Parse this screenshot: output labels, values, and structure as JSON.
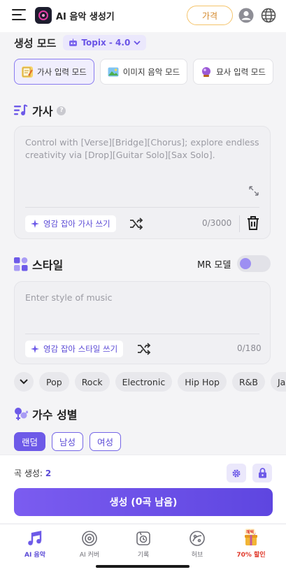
{
  "header": {
    "app_title": "AI 음악 생성기",
    "price_button": "가격"
  },
  "mode_section": {
    "label": "생성 모드",
    "model": "Topix - 4.0",
    "tabs": [
      {
        "label": "가사 입력 모드",
        "icon": "memo-icon",
        "active": true
      },
      {
        "label": "이미지 음악 모드",
        "icon": "image-icon",
        "active": false
      },
      {
        "label": "묘사 입력 모드",
        "icon": "crystal-ball-icon",
        "active": false
      }
    ]
  },
  "lyrics": {
    "title": "가사",
    "help": "?",
    "placeholder": "Control with [Verse][Bridge][Chorus]; explore endless creativity via [Drop][Guitar Solo][Sax Solo].",
    "inspire_button": "영감 잡아 가사 쓰기",
    "counter": "0/3000"
  },
  "style": {
    "title": "스타일",
    "mr_label": "MR 모델",
    "placeholder": "Enter style of music",
    "inspire_button": "영감 잡아 스타일 쓰기",
    "counter": "0/180",
    "genres": [
      "Pop",
      "Rock",
      "Electronic",
      "Hip Hop",
      "R&B",
      "Jazz"
    ]
  },
  "singer": {
    "title": "가수 성별",
    "options": [
      {
        "label": "랜덤",
        "active": true
      },
      {
        "label": "남성",
        "active": false
      },
      {
        "label": "여성",
        "active": false
      }
    ]
  },
  "bottom": {
    "song_count_label": "곡 생성:",
    "song_count_value": "2",
    "generate_prefix": "생성 (",
    "generate_bold": "0",
    "generate_suffix": "곡 남음)"
  },
  "nav": {
    "items": [
      {
        "label": "AI 음악",
        "icon": "music-note-icon",
        "active": true
      },
      {
        "label": "AI 커버",
        "icon": "vinyl-icon",
        "active": false
      },
      {
        "label": "기록",
        "icon": "history-icon",
        "active": false
      },
      {
        "label": "허브",
        "icon": "hub-icon",
        "active": false
      },
      {
        "label": "70% 할인",
        "icon": "gift-icon",
        "badge": "혜택",
        "active": false
      }
    ]
  },
  "colors": {
    "accent": "#6d5ae8",
    "price": "#f5c46b",
    "promo": "#e0392b"
  }
}
